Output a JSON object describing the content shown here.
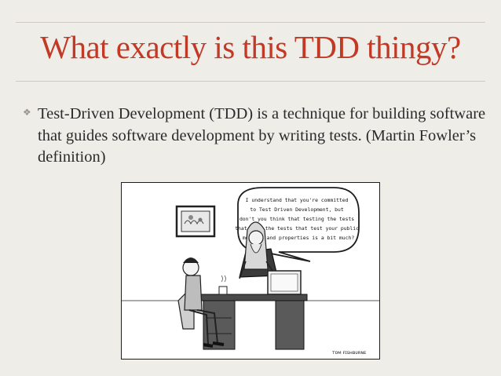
{
  "slide": {
    "title": "What exactly is this TDD thingy?",
    "bullet_symbol": "❖",
    "bullet_text": "Test-Driven Development (TDD) is a technique for building software that guides software development by writing tests. (Martin Fowler’s definition)"
  },
  "cartoon": {
    "speech_bubble": [
      "I understand that you're committed",
      "to Test Driven Development, but",
      "don't you think that testing the tests",
      "that test the tests that test your public",
      "methods and properties is a bit much?"
    ],
    "signature": "ᴛᴏᴍ ꜰɪꜱʜʙᴜʀɴᴇ"
  }
}
